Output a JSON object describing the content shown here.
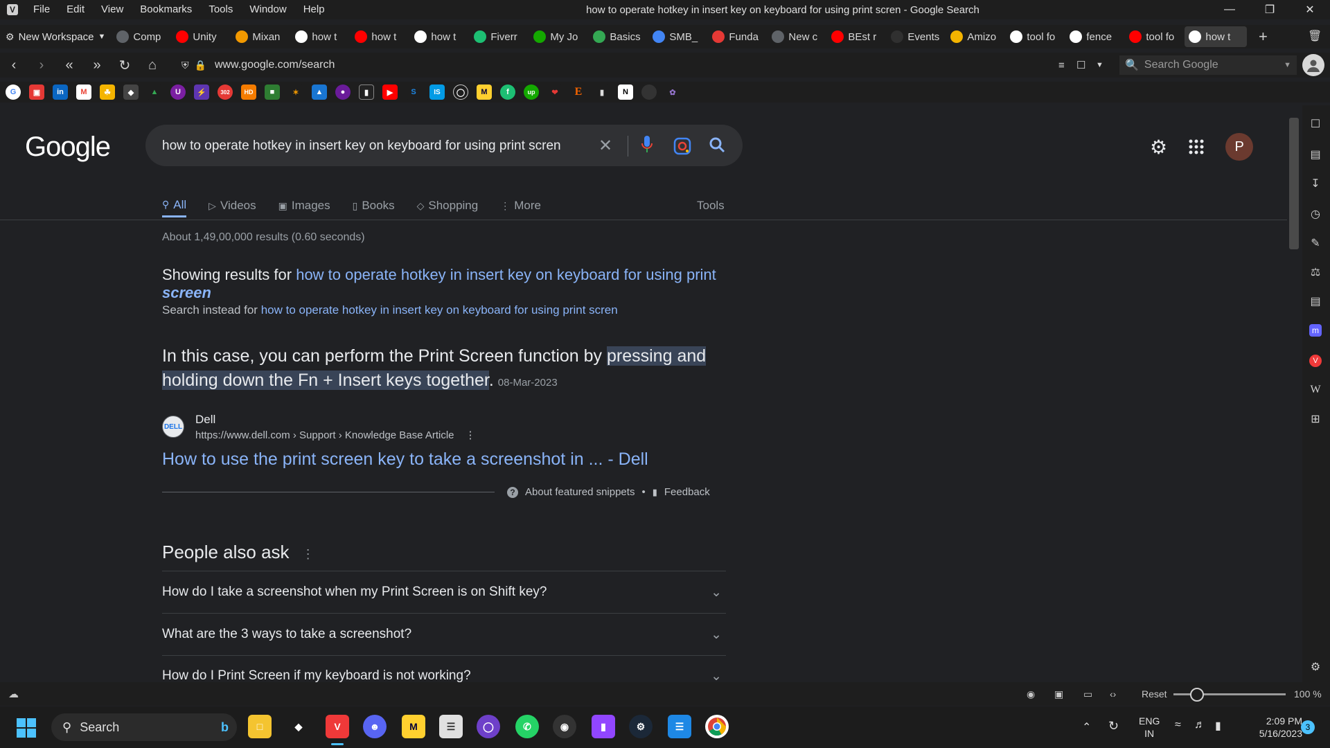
{
  "menu": [
    "File",
    "Edit",
    "View",
    "Bookmarks",
    "Tools",
    "Window",
    "Help"
  ],
  "window_title": "how to operate hotkey in insert key on keyboard for using print scren - Google Search",
  "workspace_label": "New Workspace",
  "tabs": [
    {
      "label": "Comp",
      "color": "#5f6368"
    },
    {
      "label": "Unity",
      "color": "#ff0000"
    },
    {
      "label": "Mixan",
      "color": "#f29900"
    },
    {
      "label": "how t",
      "color": "#ffffff"
    },
    {
      "label": "how t",
      "color": "#ff0000"
    },
    {
      "label": "how t",
      "color": "#ffffff"
    },
    {
      "label": "Fiverr",
      "color": "#1dbf73"
    },
    {
      "label": "My Jo",
      "color": "#14a800"
    },
    {
      "label": "Basics",
      "color": "#34a853"
    },
    {
      "label": "SMB_",
      "color": "#4285f4"
    },
    {
      "label": "Funda",
      "color": "#e53935"
    },
    {
      "label": "New c",
      "color": "#5f6368"
    },
    {
      "label": "BEst r",
      "color": "#ff0000"
    },
    {
      "label": "Events",
      "color": "#303030"
    },
    {
      "label": "Amizo",
      "color": "#f4b400"
    },
    {
      "label": "tool fo",
      "color": "#ffffff"
    },
    {
      "label": "fence",
      "color": "#ffffff"
    },
    {
      "label": "tool fo",
      "color": "#ff0000"
    },
    {
      "label": "how t",
      "color": "#ffffff"
    }
  ],
  "url": "www.google.com/search",
  "browser_search_placeholder": "Search Google",
  "google_logo": "Google",
  "query": "how to operate hotkey in insert key on keyboard for using print scren",
  "avatar_letter": "P",
  "search_tabs": [
    "All",
    "Videos",
    "Images",
    "Books",
    "Shopping",
    "More"
  ],
  "tools_label": "Tools",
  "results_count": "About 1,49,00,000 results (0.60 seconds)",
  "showing": {
    "prefix": "Showing results for ",
    "link_part": "how to operate hotkey in insert key on keyboard for using print ",
    "link_bold": "screen"
  },
  "instead": {
    "prefix": "Search instead for ",
    "link": "how to operate hotkey in insert key on keyboard for using print scren"
  },
  "snippet": {
    "plain": "In this case, you can perform the Print Screen function by ",
    "highlight": "pressing and holding down the Fn + Insert keys together",
    "end": ".",
    "date": "08-Mar-2023"
  },
  "source": {
    "icon_text": "DELL",
    "name": "Dell",
    "url": "https://www.dell.com › Support › Knowledge Base Article",
    "title": "How to use the print screen key to take a screenshot in ... - Dell"
  },
  "snippet_footer": {
    "about": "About featured snippets",
    "dot": "•",
    "feedback": "Feedback"
  },
  "paa_title": "People also ask",
  "paa_questions": [
    "How do I take a screenshot when my Print Screen is on Shift key?",
    "What are the 3 ways to take a screenshot?",
    "How do I Print Screen if my keyboard is not working?"
  ],
  "status": {
    "reset": "Reset",
    "zoom": "100 %"
  },
  "taskbar": {
    "search_placeholder": "Search",
    "lang_top": "ENG",
    "lang_bottom": "IN",
    "time": "2:09 PM",
    "date": "5/16/2023",
    "notif_count": "3"
  }
}
